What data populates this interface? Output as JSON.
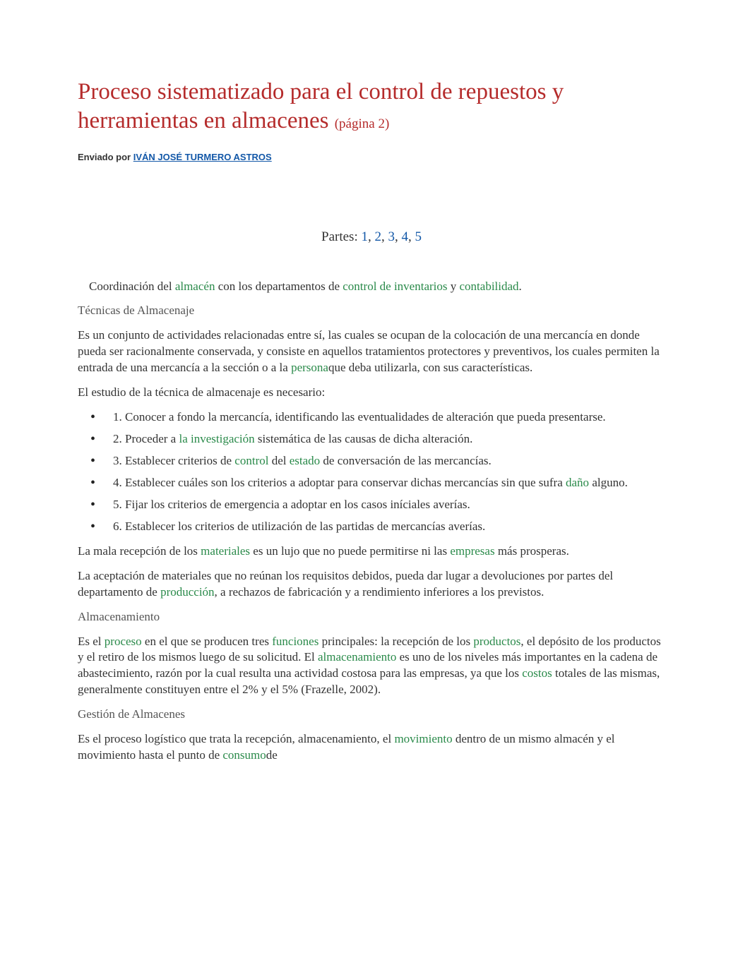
{
  "title": {
    "main": "Proceso sistematizado para el control de repuestos y herramientas en almacenes",
    "page_suffix": "(página 2)"
  },
  "byline": {
    "prefix": "Enviado por ",
    "author": "IVÁN JOSÉ TURMERO ASTROS"
  },
  "partes": {
    "prefix": "Partes: ",
    "sep": ", ",
    "pages": [
      "1",
      "2",
      "3",
      "4",
      "5"
    ]
  },
  "body": {
    "p1_a": "Coordinación del ",
    "p1_kw1": "almacén ",
    "p1_b": "con los departamentos de ",
    "p1_kw2": "control de inventarios",
    "p1_c": " y ",
    "p1_kw3": "contabilidad",
    "p1_d": ".",
    "sub1": "Técnicas de Almacenaje",
    "p2_a": "Es un conjunto de actividades relacionadas entre sí, las cuales se ocupan de la colocación de una mercancía en donde pueda ser racionalmente conservada, y consiste en aquellos tratamientos protectores y preventivos, los cuales permiten la entrada de una mercancía a la sección o a la ",
    "p2_kw1": "persona",
    "p2_b": "que deba utilizarla, con sus características.",
    "p3": "El estudio de la técnica de almacenaje es necesario:",
    "li1": "1. Conocer a fondo la mercancía, identificando las eventualidades de alteración que pueda presentarse.",
    "li2_a": "2. Proceder a ",
    "li2_kw1": "la investigación",
    "li2_b": " sistemática de las causas de dicha alteración.",
    "li3_a": "3. Establecer criterios de ",
    "li3_kw1": "control",
    "li3_b": " del ",
    "li3_kw2": "estado",
    "li3_c": " de conversación de las mercancías.",
    "li4_a": "4. Establecer cuáles son los criterios a adoptar para conservar dichas mercancías sin que sufra ",
    "li4_kw1": "daño",
    "li4_b": " alguno.",
    "li5": "5. Fijar los criterios de emergencia a adoptar en los casos iníciales averías.",
    "li6": "6. Establecer los criterios de utilización de las partidas de mercancías averías.",
    "p4_a": "La mala recepción de los ",
    "p4_kw1": "materiales",
    "p4_b": " es un lujo que no puede permitirse ni las ",
    "p4_kw2": "empresas",
    "p4_c": " más prosperas.",
    "p5_a": "La aceptación de materiales que no reúnan los requisitos debidos, pueda dar lugar a devoluciones por partes del departamento de ",
    "p5_kw1": "producción",
    "p5_b": ", a rechazos de fabricación y a rendimiento inferiores a los previstos.",
    "sub2": "Almacenamiento",
    "p6_a": "Es el ",
    "p6_kw1": "proceso",
    "p6_b": " en el que se producen tres ",
    "p6_kw2": "funciones",
    "p6_c": " principales: la recepción de los ",
    "p6_kw3": "productos",
    "p6_d": ", el depósito de los productos y el retiro de los mismos luego de su solicitud. El ",
    "p6_kw4": "almacenamiento",
    "p6_e": " es uno de los niveles más importantes en la cadena de abastecimiento, razón por la cual resulta una actividad costosa para las empresas, ya que los ",
    "p6_kw5": "costos",
    "p6_f": " totales de las mismas, generalmente constituyen entre el 2% y el 5% (Frazelle, 2002).",
    "sub3": "Gestión de Almacenes",
    "p7_a": "Es el proceso logístico que trata la recepción, almacenamiento, el ",
    "p7_kw1": "movimiento",
    "p7_b": " dentro de un mismo almacén y el movimiento hasta el punto de ",
    "p7_kw2": "consumo",
    "p7_c": "de"
  }
}
